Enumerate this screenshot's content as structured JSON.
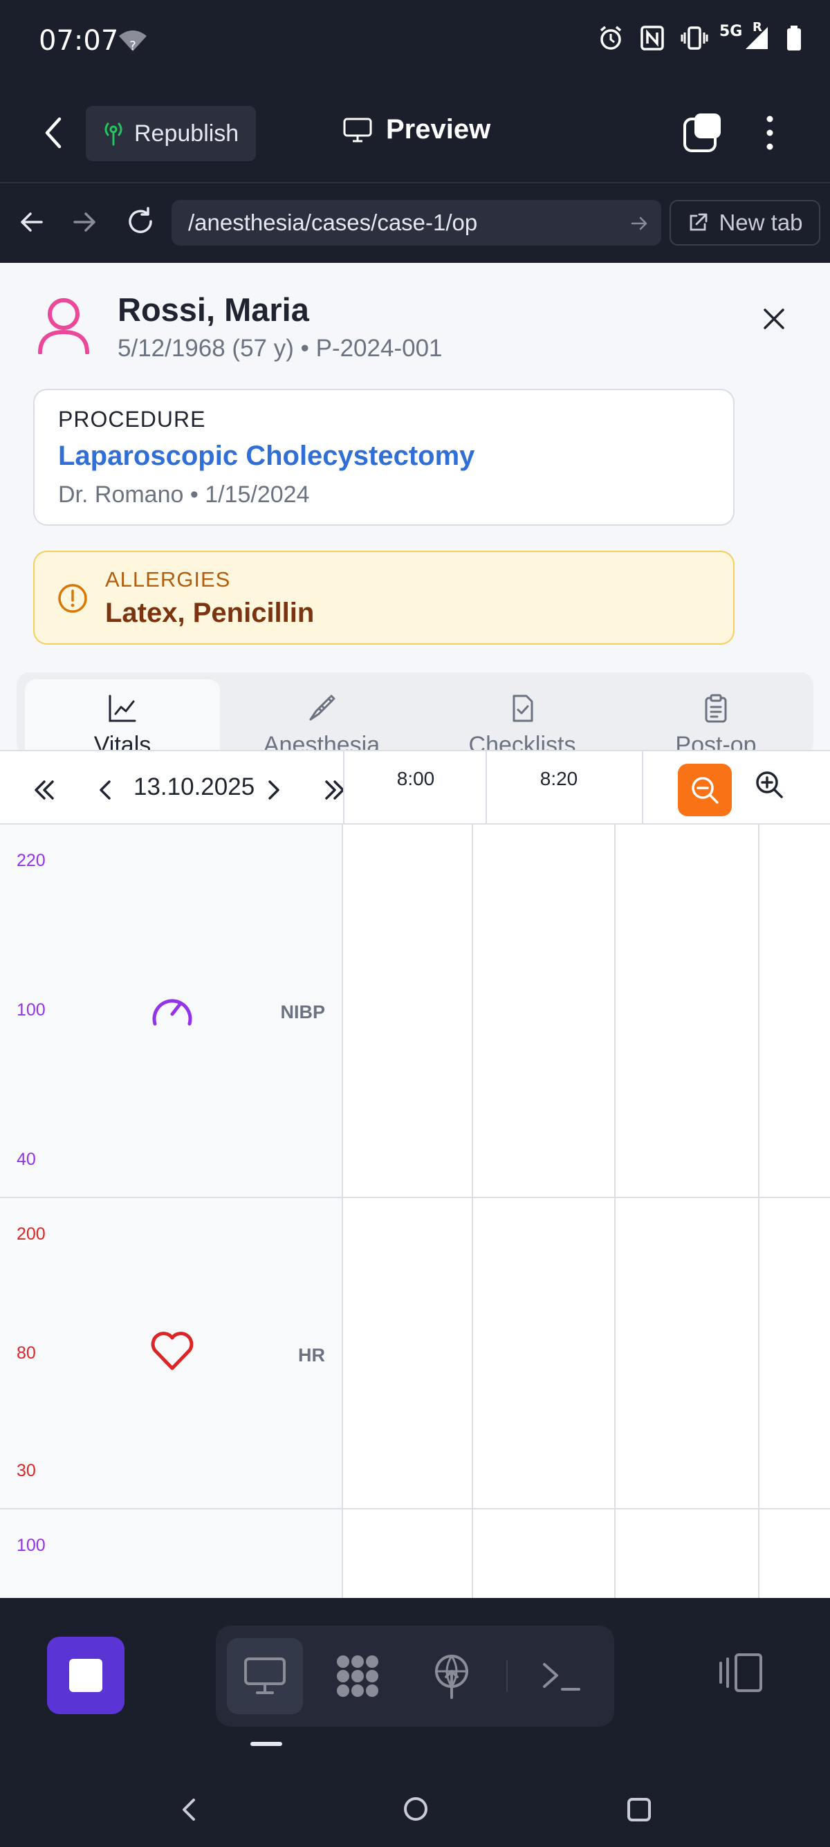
{
  "status_bar": {
    "time": "07:07",
    "wifi_badge": "?",
    "network": "5G",
    "roaming": "R",
    "icons": [
      "wifi-icon",
      "alarm-icon",
      "nfc-icon",
      "vibrate-icon",
      "signal-icon",
      "battery-icon"
    ]
  },
  "app_bar": {
    "republish_label": "Republish",
    "preview_label": "Preview"
  },
  "browser": {
    "url": "/anesthesia/cases/case-1/op",
    "new_tab_label": "New tab"
  },
  "patient": {
    "name": "Rossi, Maria",
    "meta": "5/12/1968 (57 y) • P-2024-001"
  },
  "procedure": {
    "label": "PROCEDURE",
    "name": "Laparoscopic Cholecystectomy",
    "meta": "Dr. Romano • 1/15/2024"
  },
  "allergies": {
    "label": "ALLERGIES",
    "value": "Latex, Penicillin"
  },
  "tabs": [
    {
      "label": "Vitals",
      "icon": "line-chart-icon",
      "active": true
    },
    {
      "label": "Anesthesia",
      "icon": "syringe-icon",
      "active": false
    },
    {
      "label": "Checklists",
      "icon": "file-check-icon",
      "active": false
    },
    {
      "label": "Post-op",
      "icon": "clipboard-icon",
      "active": false
    }
  ],
  "chart_toolbar": {
    "date": "13.10.2025",
    "times": [
      "8:00",
      "8:20"
    ]
  },
  "vitals": [
    {
      "name": "NIBP",
      "icon": "gauge-icon",
      "color": "#9333ea",
      "scale": [
        "220",
        "100",
        "40"
      ]
    },
    {
      "name": "HR",
      "icon": "heart-icon",
      "color": "#dc2626",
      "scale": [
        "200",
        "80",
        "30"
      ]
    },
    {
      "name": "",
      "icon": "",
      "color": "#9333ea",
      "scale": [
        "100"
      ]
    }
  ],
  "colors": {
    "accent_orange": "#f97316",
    "link_blue": "#2f6fd6",
    "dock_purple": "#5b34d6"
  }
}
